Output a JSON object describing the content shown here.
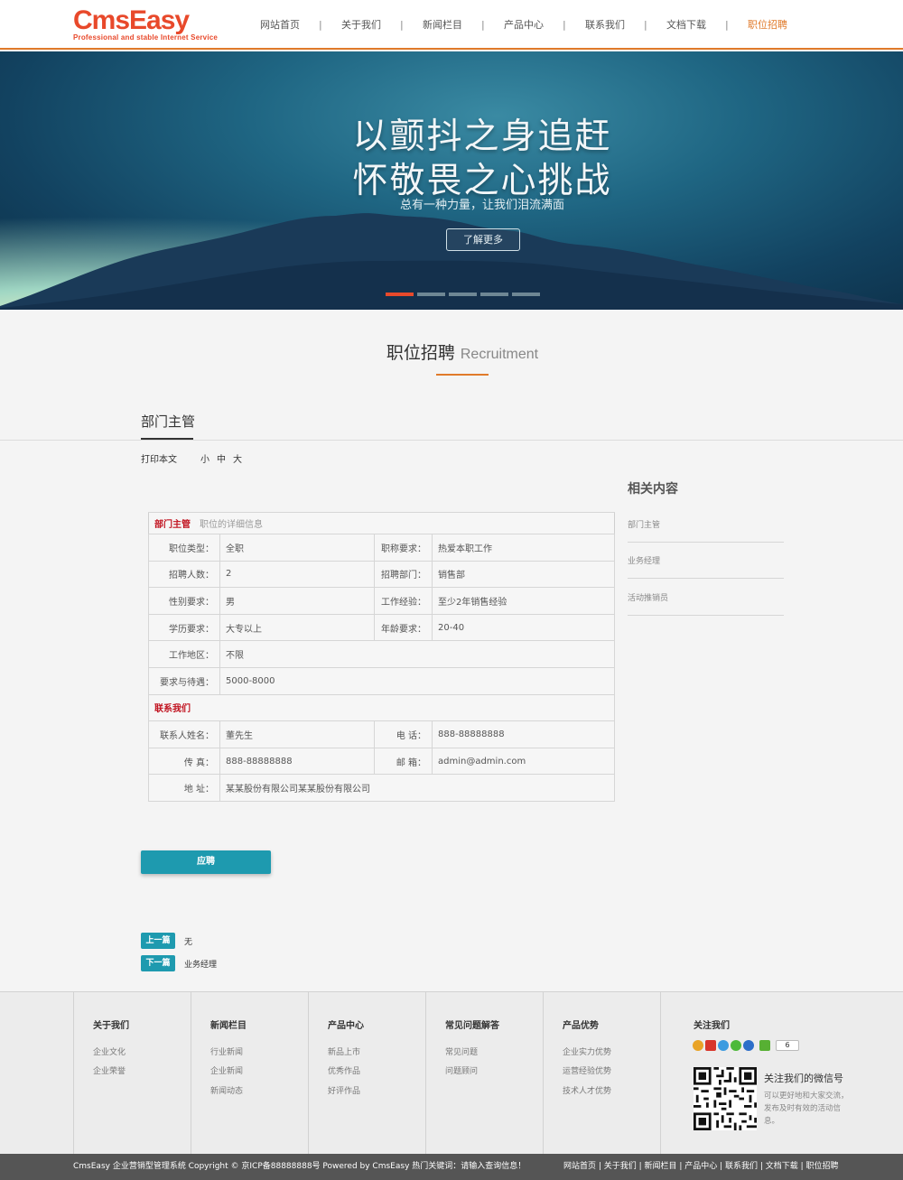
{
  "brand": {
    "logo_text": "CmsEasy",
    "tagline": "Professional and stable Internet Service",
    "accent": "#e07a2a",
    "logo_color": "#e8492b",
    "teal": "#1e9aaf"
  },
  "nav": [
    "网站首页",
    "关于我们",
    "新闻栏目",
    "产品中心",
    "联系我们",
    "文档下载",
    "职位招聘"
  ],
  "nav_separator": "|",
  "banner": {
    "title_line1": "以颤抖之身追赶",
    "title_line2": "怀敬畏之心挑战",
    "subtitle": "总有一种力量，让我们泪流满面",
    "button": "了解更多",
    "slides": 5,
    "active_slide": 1
  },
  "section": {
    "title_cn": "职位招聘",
    "title_en": "Recruitment"
  },
  "page_title": "部门主管",
  "tools": {
    "print": "打印本文",
    "small": "小",
    "medium": "中",
    "large": "大"
  },
  "job": {
    "heading": "部门主管",
    "heading_note": "职位的详细信息",
    "rows": [
      {
        "l1": "职位类型：",
        "v1": "全职",
        "l2": "职称要求：",
        "v2": "热爱本职工作"
      },
      {
        "l1": "招聘人数：",
        "v1": "2",
        "l2": "招聘部门：",
        "v2": "销售部"
      },
      {
        "l1": "性别要求：",
        "v1": "男",
        "l2": "工作经验：",
        "v2": "至少2年销售经验"
      },
      {
        "l1": "学历要求：",
        "v1": "大专以上",
        "l2": "年龄要求：",
        "v2": "20-40"
      }
    ],
    "area_label": "工作地区：",
    "area_value": "不限",
    "salary_label": "要求与待遇：",
    "salary_value": "5000-8000",
    "contact_heading": "联系我们",
    "contact_name_label": "联系人姓名：",
    "contact_name": "董先生",
    "phone_label": "电 话：",
    "phone": "888-88888888",
    "fax_label": "传 真：",
    "fax": "888-88888888",
    "email_label": "邮 箱：",
    "email": "admin@admin.com",
    "address_label": "地 址：",
    "address": "某某股份有限公司某某股份有限公司"
  },
  "apply_button": "应聘",
  "related": {
    "title": "相关内容",
    "items": [
      "部门主管",
      "业务经理",
      "活动推销员"
    ]
  },
  "prevnext": {
    "prev_label": "上一篇",
    "prev_value": "无",
    "next_label": "下一篇",
    "next_value": "业务经理"
  },
  "footer": {
    "columns": [
      {
        "title": "关于我们",
        "links": [
          "企业文化",
          "企业荣誉"
        ]
      },
      {
        "title": "新闻栏目",
        "links": [
          "行业新闻",
          "企业新闻",
          "新闻动态"
        ]
      },
      {
        "title": "产品中心",
        "links": [
          "新品上市",
          "优秀作品",
          "好评作品"
        ]
      },
      {
        "title": "常见问题解答",
        "links": [
          "常见问题",
          "问题顾问"
        ]
      },
      {
        "title": "产品优势",
        "links": [
          "企业实力优势",
          "运营经验优势",
          "技术人才优势"
        ]
      }
    ],
    "follow": {
      "title": "关注我们",
      "share_count": "6",
      "qr_title": "关注我们的微信号",
      "qr_desc": "可以更好地和大家交流，发布及时有效的活动信息。"
    }
  },
  "bottom": {
    "copyright": "CmsEasy 企业营销型管理系统  Copyright ©  京ICP备88888888号  Powered by CmsEasy  热门关键词：请输入查询信息！",
    "links": "网站首页 | 关于我们 | 新闻栏目 | 产品中心 | 联系我们 | 文档下载 | 职位招聘"
  }
}
